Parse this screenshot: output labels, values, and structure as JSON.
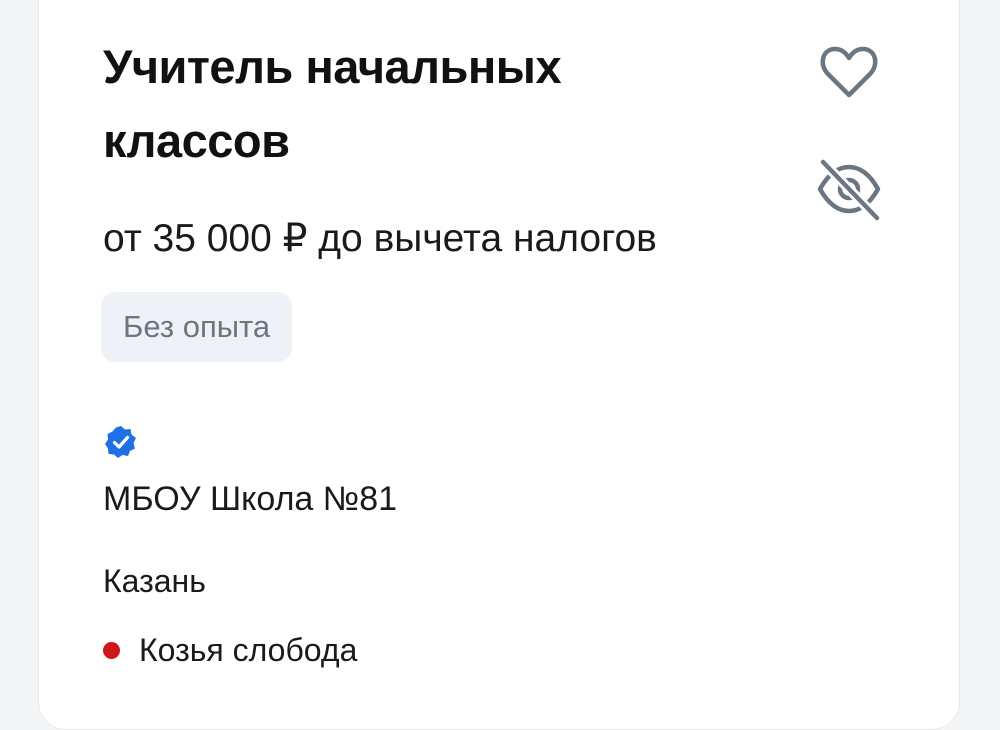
{
  "vacancy": {
    "title": "Учитель начальных классов",
    "salary": "от 35 000 ₽ до вычета налогов",
    "experience_badge": "Без опыта",
    "company": "МБОУ Школа №81",
    "city": "Казань",
    "metro_station": "Козья слобода"
  },
  "icons": {
    "favorite": "heart-icon",
    "hide": "eye-off-icon",
    "verified": "verified-check-icon",
    "metro": "metro-dot-icon"
  },
  "colors": {
    "verified": "#1f6fe5",
    "metro_line": "#d0161d",
    "badge_bg": "#eef1f6",
    "badge_text": "#6b7683",
    "icon_gray": "#6b7683"
  }
}
